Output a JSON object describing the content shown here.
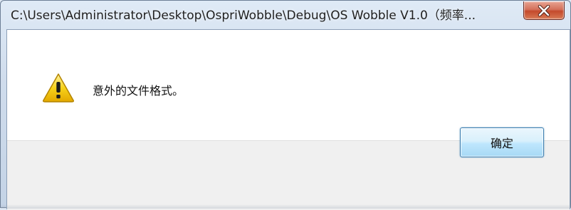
{
  "window": {
    "title": "C:\\Users\\Administrator\\Desktop\\OspriWobble\\Debug\\OS Wobble V1.0（频率..."
  },
  "titlebar": {
    "close_icon": "close-x-icon"
  },
  "dialog": {
    "icon": "warning-icon",
    "message": "意外的文件格式。"
  },
  "buttons": {
    "ok_label": "确定"
  },
  "colors": {
    "warning_yellow": "#f5c400",
    "close_red": "#c44a2c",
    "button_border": "#3c7fb1"
  }
}
